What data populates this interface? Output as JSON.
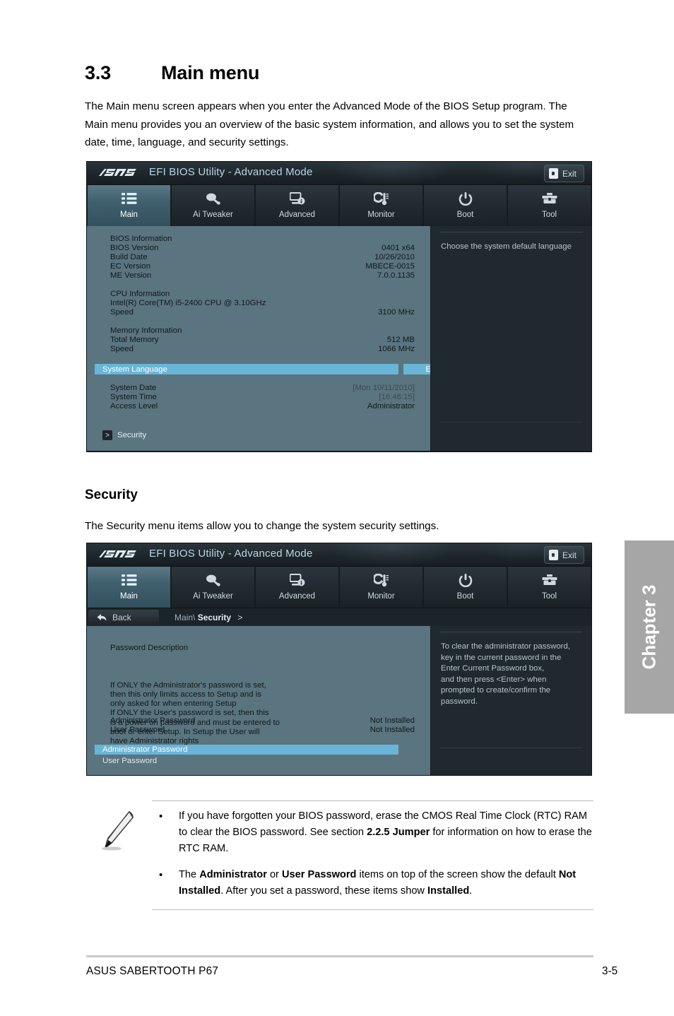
{
  "document": {
    "section_number": "3.3",
    "section_title": "Main menu",
    "intro": "The Main menu screen appears when you enter the Advanced Mode of the BIOS Setup program. The Main menu provides you an overview of the basic system information, and allows you to set the system date, time, language, and security settings.",
    "subsection_title": "Security",
    "subsection_intro": "The Security menu items allow you to change the system security settings."
  },
  "bios_common": {
    "title": "EFI BIOS Utility - Advanced Mode",
    "logo_text": "ASUS",
    "exit_label": "Exit",
    "tabs": [
      {
        "label": "Main",
        "icon": "list-icon",
        "active": true
      },
      {
        "label": "Ai  Tweaker",
        "icon": "tweaker-icon",
        "active": false
      },
      {
        "label": "Advanced",
        "icon": "advanced-monitor-icon",
        "active": false
      },
      {
        "label": "Monitor",
        "icon": "thermometer-icon",
        "active": false
      },
      {
        "label": "Boot",
        "icon": "power-icon",
        "active": false
      },
      {
        "label": "Tool",
        "icon": "toolbox-icon",
        "active": false
      }
    ]
  },
  "main_screen": {
    "sections": {
      "bios_information_heading": "BIOS Information",
      "cpu_information_heading": "CPU Information",
      "memory_information_heading": "Memory Information"
    },
    "rows": [
      {
        "key": "BIOS Version",
        "value": "0401 x64"
      },
      {
        "key": "Build Date",
        "value": "10/26/2010"
      },
      {
        "key": "EC Version",
        "value": "MBECE-0015"
      },
      {
        "key": "ME Version",
        "value": "7.0.0.1135"
      }
    ],
    "cpu_model": "Intel(R) Core(TM) i5-2400 CPU @ 3.10GHz",
    "cpu_speed": {
      "key": "Speed",
      "value": "3100 MHz"
    },
    "memory_rows": [
      {
        "key": "Total Memory",
        "value": "512 MB"
      },
      {
        "key": "Speed",
        "value": "1066 MHz"
      }
    ],
    "selected_item": {
      "key": "System Language",
      "value": "English"
    },
    "settings_rows": [
      {
        "key": "System Date",
        "value": "[Mon 10/11/2010]",
        "dim": true
      },
      {
        "key": "System Time",
        "value": "[16:46:15]",
        "dim": true
      },
      {
        "key": "Access Level",
        "value": "Administrator",
        "dim": false
      }
    ],
    "submenu": {
      "chevron": ">",
      "label": "Security"
    },
    "help_text": "Choose the system default language"
  },
  "security_screen": {
    "back_label": "Back",
    "breadcrumb_root": "Main\\",
    "breadcrumb_current": "Security",
    "breadcrumb_arrow": ">",
    "description_heading": "Password Description",
    "description_body": "If ONLY the Administrator's password is set,\nthen this only limits access to Setup and is\nonly asked for when entering Setup\nIf ONLY the User's password is set, then this\nis a power on password and must be entered to\nboot or enter Setup. In Setup the User will\nhave Administrator rights",
    "status_rows": [
      {
        "key": "Administrator Password",
        "value": "Not Installed"
      },
      {
        "key": "User Password",
        "value": "Not Installed"
      }
    ],
    "action_rows": [
      {
        "label": "Administrator Password",
        "selected": true
      },
      {
        "label": "User Password",
        "selected": false
      }
    ],
    "help_text": "To clear the administrator password,\nkey in the current password in the\nEnter Current Password box,\nand then press <Enter> when\nprompted to create/confirm the\npassword."
  },
  "note": {
    "bullet_symbol": "•",
    "items": [
      {
        "parts": [
          {
            "t": "If you have forgotten your BIOS password, erase the CMOS Real Time Clock (RTC) RAM to clear the BIOS password. See section ",
            "b": false
          },
          {
            "t": "2.2.5 Jumper",
            "b": true
          },
          {
            "t": " for information on how to erase the RTC RAM.",
            "b": false
          }
        ]
      },
      {
        "parts": [
          {
            "t": "The ",
            "b": false
          },
          {
            "t": "Administrator",
            "b": true
          },
          {
            "t": " or ",
            "b": false
          },
          {
            "t": "User Password",
            "b": true
          },
          {
            "t": " items on top of the screen show the default ",
            "b": false
          },
          {
            "t": "Not Installed",
            "b": true
          },
          {
            "t": ". After you set a password, these items show ",
            "b": false
          },
          {
            "t": "Installed",
            "b": true
          },
          {
            "t": ".",
            "b": false
          }
        ]
      }
    ]
  },
  "chapter_tab": {
    "label": "Chapter 3"
  },
  "footer": {
    "left": "ASUS SABERTOOTH P67",
    "right": "3-5"
  }
}
